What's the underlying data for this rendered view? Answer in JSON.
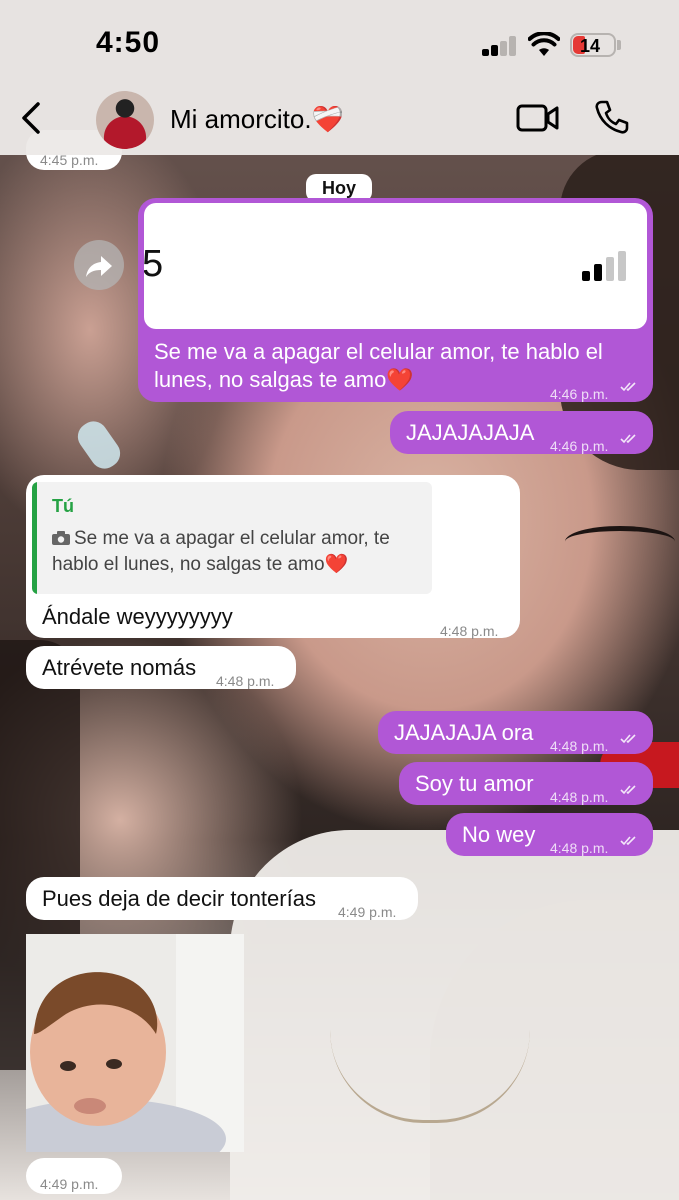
{
  "status_bar": {
    "time": "4:50",
    "battery": "14"
  },
  "header": {
    "title": "Mi amorcito.❤️‍🩹"
  },
  "prev_time": "4:45 p.m.",
  "date_label": "Hoy",
  "messages": [
    {
      "text": "Se me va a apagar el celular amor, te hablo el lunes, no salgas te amo❤️",
      "time": "4:46 p.m.",
      "image_digit": "5"
    },
    {
      "text": "JAJAJAJAJA",
      "time": "4:46 p.m."
    },
    {
      "quote_author": "Tú",
      "quote_text": "Se me va a apagar el celular amor, te hablo el lunes, no salgas te amo❤️",
      "text": "Ándale weyyyyyyyy",
      "time": "4:48 p.m."
    },
    {
      "text": "Atrévete nomás",
      "time": "4:48 p.m."
    },
    {
      "text": "JAJAJAJA ora",
      "time": "4:48 p.m."
    },
    {
      "text": "Soy tu amor",
      "time": "4:48 p.m."
    },
    {
      "text": "No wey",
      "time": "4:48 p.m."
    },
    {
      "text": "Pues deja de decir tonterías",
      "time": "4:49 p.m."
    },
    {
      "time": "4:49 p.m."
    }
  ],
  "colors": {
    "outgoing": "#b157d6",
    "incoming": "#ffffff",
    "quote_accent": "#25a244"
  },
  "icons": [
    "back-icon",
    "video-call-icon",
    "phone-icon",
    "forward-icon",
    "camera-icon",
    "double-check-icon"
  ]
}
